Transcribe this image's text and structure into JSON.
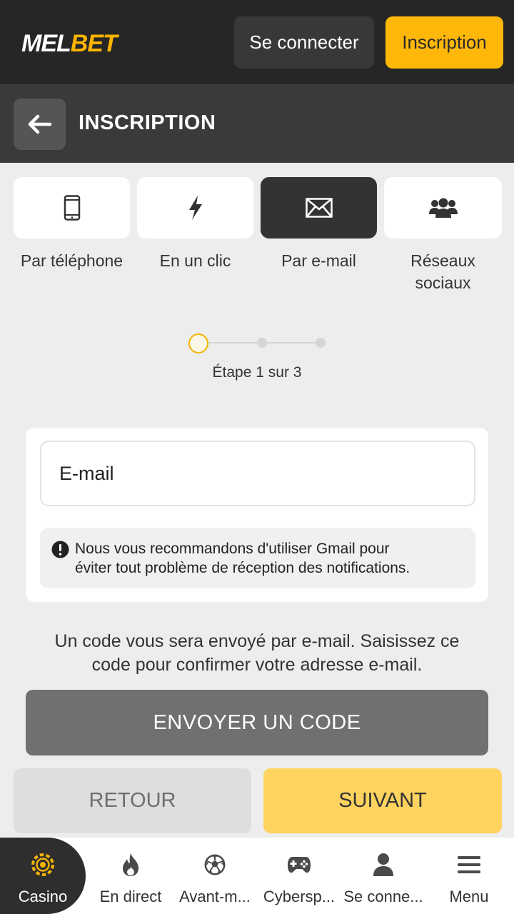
{
  "header": {
    "logo_part1": "MEL",
    "logo_part2": "BET",
    "login_label": "Se connecter",
    "signup_label": "Inscription"
  },
  "titlebar": {
    "title": "INSCRIPTION"
  },
  "tabs": [
    {
      "label": "Par téléphone",
      "icon": "phone-icon",
      "active": false
    },
    {
      "label": "En un clic",
      "icon": "lightning-icon",
      "active": false
    },
    {
      "label": "Par e-mail",
      "icon": "envelope-icon",
      "active": true
    },
    {
      "label_line1": "Réseaux",
      "label_line2": "sociaux",
      "icon": "users-icon",
      "active": false
    }
  ],
  "stepper": {
    "text": "Étape 1 sur 3",
    "current": 1,
    "total": 3
  },
  "form": {
    "email_placeholder": "E-mail",
    "notice_line1": "Nous vous recommandons d'utiliser Gmail pour",
    "notice_line2": "éviter tout problème de réception des notifications."
  },
  "info": {
    "line1": "Un code vous sera envoyé par e-mail. Saisissez ce",
    "line2": "code pour confirmer votre adresse e-mail."
  },
  "buttons": {
    "send_code": "ENVOYER UN CODE",
    "back": "RETOUR",
    "next": "SUIVANT"
  },
  "bottom_nav": [
    {
      "label": "Casino",
      "icon": "casino-chip-icon",
      "active": true
    },
    {
      "label": "En direct",
      "icon": "flame-icon",
      "active": false
    },
    {
      "label": "Avant-m...",
      "icon": "soccer-ball-icon",
      "active": false
    },
    {
      "label": "Cybersp...",
      "icon": "gamepad-icon",
      "active": false
    },
    {
      "label": "Se conne...",
      "icon": "user-icon",
      "active": false
    },
    {
      "label": "Menu",
      "icon": "hamburger-menu-icon",
      "active": false
    }
  ],
  "colors": {
    "accent": "#ffb80a",
    "header_bg": "#262626",
    "titlebar_bg": "#3a3a3a",
    "send_button": "#707070",
    "next_button": "#ffd35f"
  }
}
